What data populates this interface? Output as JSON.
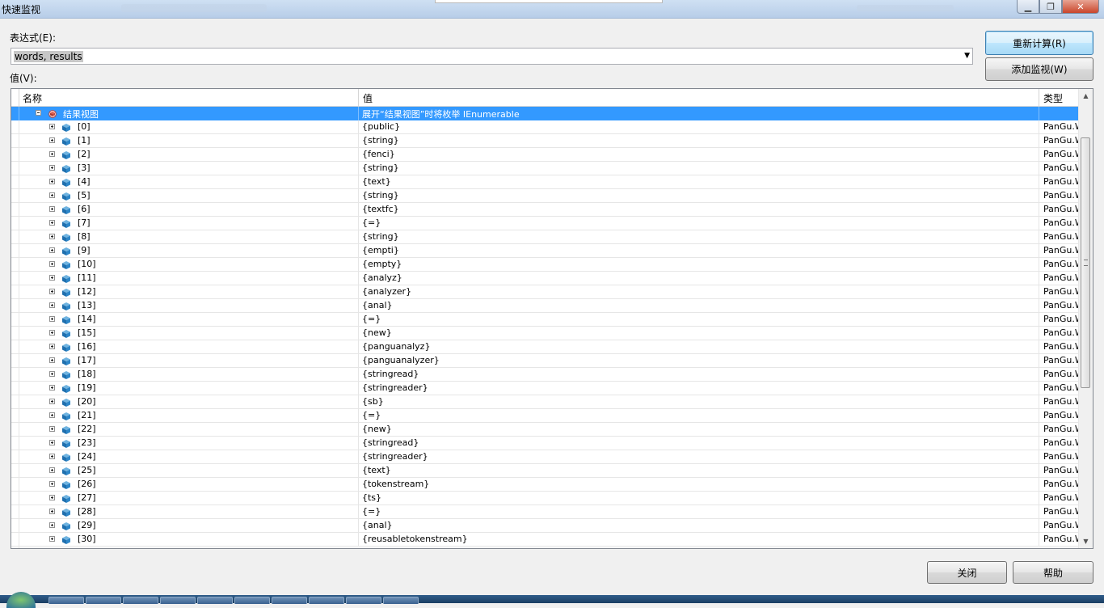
{
  "window": {
    "title": "快速监视",
    "min_icon": "minimize-icon",
    "max_icon": "restore-icon",
    "close_icon": "close-icon",
    "close_glyph": "✕",
    "min_glyph": "▁",
    "max_glyph": "❐"
  },
  "expression": {
    "label": "表达式(E):",
    "value": "words, results",
    "dropdown_glyph": "▼"
  },
  "buttons": {
    "recalculate": "重新计算(R)",
    "add_watch": "添加监视(W)",
    "close": "关闭",
    "help": "帮助"
  },
  "value_label": "值(V):",
  "grid": {
    "columns": [
      "名称",
      "值",
      "类型"
    ],
    "root": {
      "name": "结果视图",
      "value": "展开“结果视图”时将枚举 IEnumerable",
      "type": ""
    },
    "rows": [
      {
        "name": "[0]",
        "value": "{public}",
        "type": "PanGu.WordInfo"
      },
      {
        "name": "[1]",
        "value": "{string}",
        "type": "PanGu.WordInfo"
      },
      {
        "name": "[2]",
        "value": "{fenci}",
        "type": "PanGu.WordInfo"
      },
      {
        "name": "[3]",
        "value": "{string}",
        "type": "PanGu.WordInfo"
      },
      {
        "name": "[4]",
        "value": "{text}",
        "type": "PanGu.WordInfo"
      },
      {
        "name": "[5]",
        "value": "{string}",
        "type": "PanGu.WordInfo"
      },
      {
        "name": "[6]",
        "value": "{textfc}",
        "type": "PanGu.WordInfo"
      },
      {
        "name": "[7]",
        "value": "{=}",
        "type": "PanGu.WordInfo"
      },
      {
        "name": "[8]",
        "value": "{string}",
        "type": "PanGu.WordInfo"
      },
      {
        "name": "[9]",
        "value": "{empti}",
        "type": "PanGu.WordInfo"
      },
      {
        "name": "[10]",
        "value": "{empty}",
        "type": "PanGu.WordInfo"
      },
      {
        "name": "[11]",
        "value": "{analyz}",
        "type": "PanGu.WordInfo"
      },
      {
        "name": "[12]",
        "value": "{analyzer}",
        "type": "PanGu.WordInfo"
      },
      {
        "name": "[13]",
        "value": "{anal}",
        "type": "PanGu.WordInfo"
      },
      {
        "name": "[14]",
        "value": "{=}",
        "type": "PanGu.WordInfo"
      },
      {
        "name": "[15]",
        "value": "{new}",
        "type": "PanGu.WordInfo"
      },
      {
        "name": "[16]",
        "value": "{panguanalyz}",
        "type": "PanGu.WordInfo"
      },
      {
        "name": "[17]",
        "value": "{panguanalyzer}",
        "type": "PanGu.WordInfo"
      },
      {
        "name": "[18]",
        "value": "{stringread}",
        "type": "PanGu.WordInfo"
      },
      {
        "name": "[19]",
        "value": "{stringreader}",
        "type": "PanGu.WordInfo"
      },
      {
        "name": "[20]",
        "value": "{sb}",
        "type": "PanGu.WordInfo"
      },
      {
        "name": "[21]",
        "value": "{=}",
        "type": "PanGu.WordInfo"
      },
      {
        "name": "[22]",
        "value": "{new}",
        "type": "PanGu.WordInfo"
      },
      {
        "name": "[23]",
        "value": "{stringread}",
        "type": "PanGu.WordInfo"
      },
      {
        "name": "[24]",
        "value": "{stringreader}",
        "type": "PanGu.WordInfo"
      },
      {
        "name": "[25]",
        "value": "{text}",
        "type": "PanGu.WordInfo"
      },
      {
        "name": "[26]",
        "value": "{tokenstream}",
        "type": "PanGu.WordInfo"
      },
      {
        "name": "[27]",
        "value": "{ts}",
        "type": "PanGu.WordInfo"
      },
      {
        "name": "[28]",
        "value": "{=}",
        "type": "PanGu.WordInfo"
      },
      {
        "name": "[29]",
        "value": "{anal}",
        "type": "PanGu.WordInfo"
      },
      {
        "name": "[30]",
        "value": "{reusabletokenstream}",
        "type": "PanGu.WordInfo"
      }
    ]
  },
  "scrollbar": {
    "up_glyph": "▲",
    "down_glyph": "▼"
  },
  "colors": {
    "selection": "#3399ff",
    "accent": "#3c7fb1"
  }
}
